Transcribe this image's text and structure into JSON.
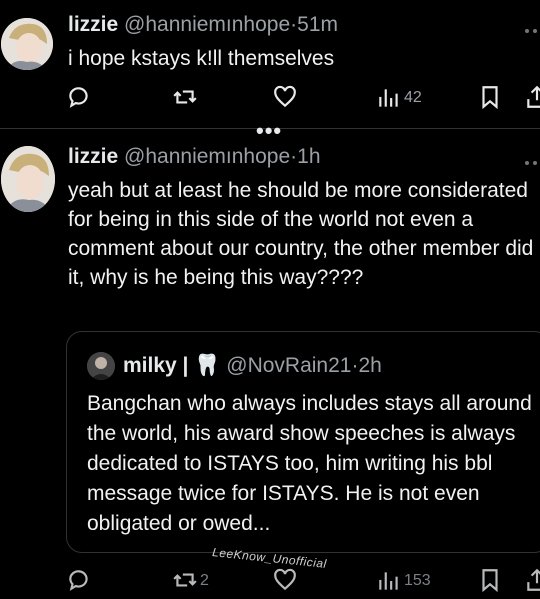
{
  "tweet1": {
    "display_name": "lizzie",
    "handle": "@hanniemınhope",
    "time": "51m",
    "text": "i hope kstays k!ll themselves",
    "views": "42"
  },
  "tweet2": {
    "display_name": "lizzie",
    "handle": "@hanniemınhope",
    "time": "1h",
    "text": "yeah but at least he should be more considerated for being in this side of the world not even a comment about our country, the other member did it, why is he being this way????",
    "retweets": "2",
    "views": "153"
  },
  "thread_separator": "•••",
  "quoted": {
    "display_name": "milky | 🦷",
    "handle": "@NovRain21",
    "time": "2h",
    "text": "Bangchan who always includes stays all around the world, his award show speeches is always dedicated to ISTAYS too, him writing his bbl message twice for ISTAYS. He is not even obligated or owed..."
  },
  "watermark": "LeeKnow_Unofficial",
  "icons": {
    "reply": "reply-icon",
    "retweet": "retweet-icon",
    "like": "heart-icon",
    "views": "views-icon",
    "bookmark": "bookmark-icon",
    "share": "share-icon",
    "more": "more-icon"
  },
  "colors": {
    "background": "#000000",
    "text": "#e7e9ea",
    "muted": "#9aa0a6",
    "border": "#2f3336"
  }
}
